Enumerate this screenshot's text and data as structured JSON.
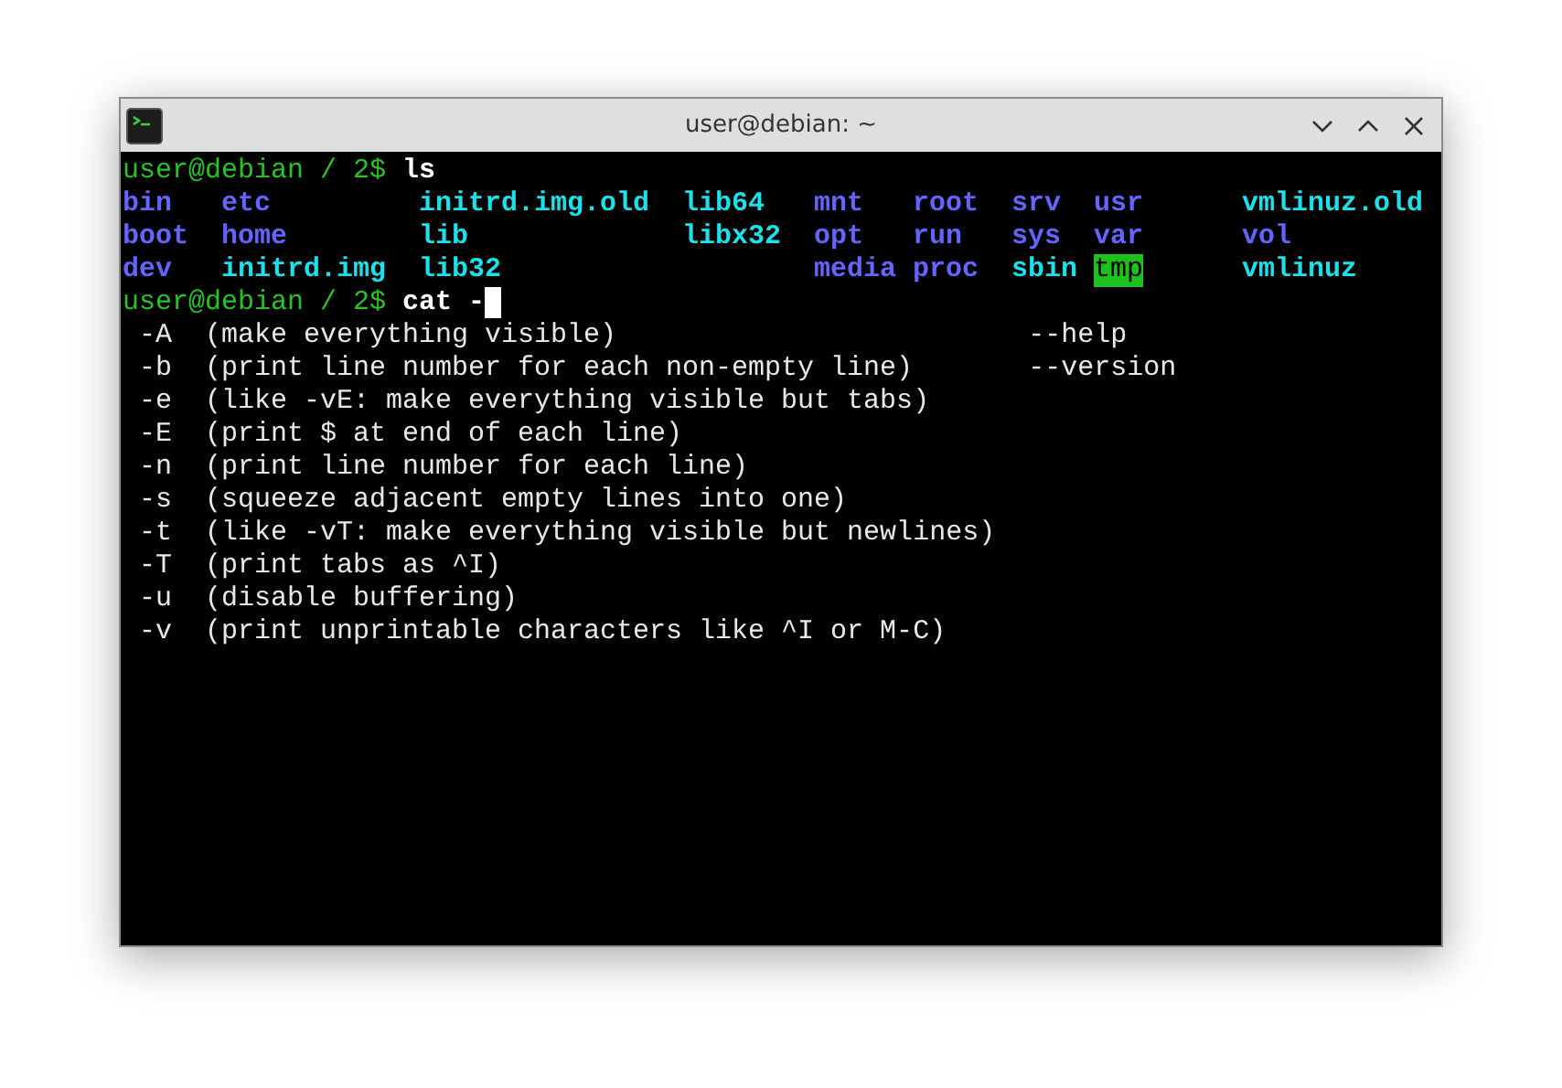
{
  "window": {
    "title": "user@debian: ~"
  },
  "terminal": {
    "first_prompt": {
      "prompt": "user@debian / 2$",
      "command": "ls"
    },
    "ls_rows": [
      [
        {
          "name": "bin",
          "kind": "dir"
        },
        {
          "name": "etc",
          "kind": "dir"
        },
        {
          "name": "initrd.img.old",
          "kind": "link"
        },
        {
          "name": "lib64",
          "kind": "link"
        },
        {
          "name": "mnt",
          "kind": "dir"
        },
        {
          "name": "root",
          "kind": "dir"
        },
        {
          "name": "srv",
          "kind": "dir"
        },
        {
          "name": "usr",
          "kind": "dir"
        },
        {
          "name": "vmlinuz.old",
          "kind": "link"
        }
      ],
      [
        {
          "name": "boot",
          "kind": "dir"
        },
        {
          "name": "home",
          "kind": "dir"
        },
        {
          "name": "lib",
          "kind": "link"
        },
        {
          "name": "libx32",
          "kind": "link"
        },
        {
          "name": "opt",
          "kind": "dir"
        },
        {
          "name": "run",
          "kind": "dir"
        },
        {
          "name": "sys",
          "kind": "dir"
        },
        {
          "name": "var",
          "kind": "dir"
        },
        {
          "name": "vol",
          "kind": "dir"
        }
      ],
      [
        {
          "name": "dev",
          "kind": "dir"
        },
        {
          "name": "initrd.img",
          "kind": "link"
        },
        {
          "name": "lib32",
          "kind": "link"
        },
        {
          "kind": "gap"
        },
        {
          "name": "media",
          "kind": "dir"
        },
        {
          "name": "proc",
          "kind": "dir"
        },
        {
          "name": "sbin",
          "kind": "link"
        },
        {
          "name": "tmp",
          "kind": "sticky"
        },
        {
          "name": "vmlinuz",
          "kind": "link"
        }
      ]
    ],
    "second_prompt": {
      "prompt": "user@debian / 2$",
      "command": "cat -"
    },
    "completions": [
      {
        "flag": "-A",
        "description": "(make everything visible)"
      },
      {
        "flag": "-b",
        "description": "(print line number for each non-empty line)"
      },
      {
        "flag": "-e",
        "description": "(like -vE: make everything visible but tabs)"
      },
      {
        "flag": "-E",
        "description": "(print $ at end of each line)"
      },
      {
        "flag": "-n",
        "description": "(print line number for each line)"
      },
      {
        "flag": "-s",
        "description": "(squeeze adjacent empty lines into one)"
      },
      {
        "flag": "-t",
        "description": "(like -vT: make everything visible but newlines)"
      },
      {
        "flag": "-T",
        "description": "(print tabs as ^I)"
      },
      {
        "flag": "-u",
        "description": "(disable buffering)"
      },
      {
        "flag": "-v",
        "description": "(print unprintable characters like ^I or M-C)"
      }
    ],
    "long_options": [
      "--help",
      "--version"
    ]
  }
}
